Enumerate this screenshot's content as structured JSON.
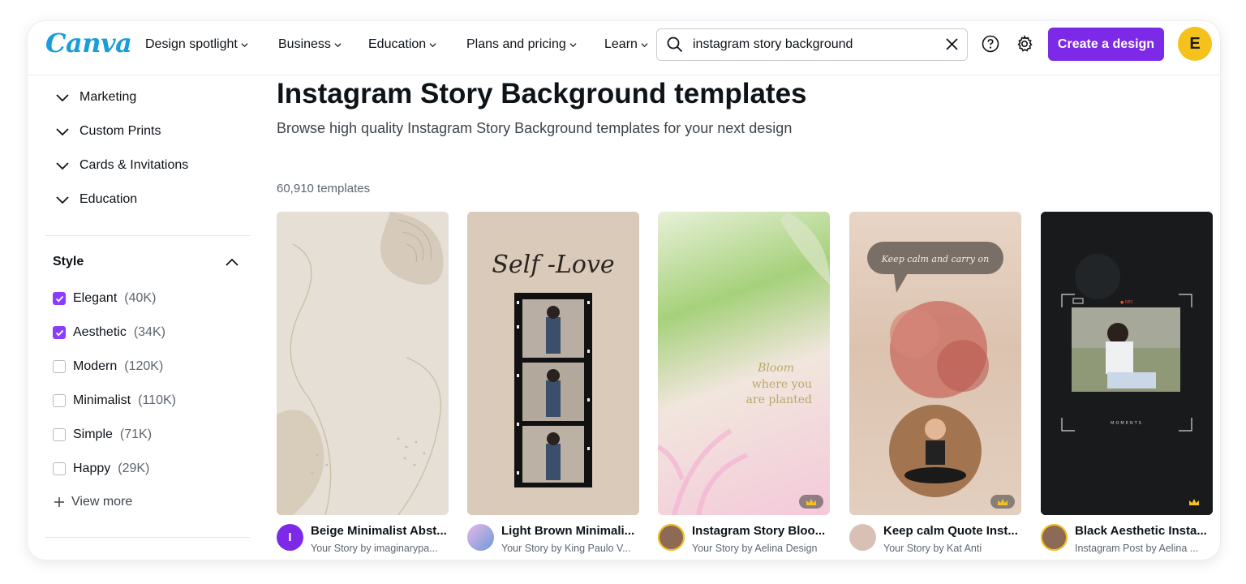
{
  "header": {
    "logo": "Canva",
    "nav": [
      {
        "label": "Design spotlight"
      },
      {
        "label": "Business"
      },
      {
        "label": "Education"
      },
      {
        "label": "Plans and pricing"
      },
      {
        "label": "Learn"
      }
    ],
    "search": {
      "value": "instagram story background",
      "placeholder": "Search"
    },
    "create_label": "Create a design",
    "avatar_initial": "E",
    "brand_color": "#7d2ae8",
    "avatar_color": "#f5c21b"
  },
  "sidebar": {
    "categories": [
      {
        "label": "Marketing"
      },
      {
        "label": "Custom Prints"
      },
      {
        "label": "Cards & Invitations"
      },
      {
        "label": "Education"
      }
    ],
    "style": {
      "heading": "Style",
      "options": [
        {
          "label": "Elegant",
          "count": "(40K)",
          "checked": true
        },
        {
          "label": "Aesthetic",
          "count": "(34K)",
          "checked": true
        },
        {
          "label": "Modern",
          "count": "(120K)",
          "checked": false
        },
        {
          "label": "Minimalist",
          "count": "(110K)",
          "checked": false
        },
        {
          "label": "Simple",
          "count": "(71K)",
          "checked": false
        },
        {
          "label": "Happy",
          "count": "(29K)",
          "checked": false
        }
      ],
      "view_more": "View more"
    }
  },
  "main": {
    "title": "Instagram Story Background templates",
    "subtitle": "Browse high quality Instagram Story Background templates for your next design",
    "count": "60,910 templates",
    "cards": [
      {
        "name": "Beige Minimalist Abst...",
        "byline": "Your Story by imaginarypa...",
        "avatar_letter": "I",
        "premium": false
      },
      {
        "name": "Light Brown Minimali...",
        "byline": "Your Story by King Paulo V...",
        "overlay": "Self -Love",
        "premium": false
      },
      {
        "name": "Instagram Story Bloo...",
        "byline": "Your Story by Aelina Design",
        "overlay_lines": [
          "Bloom",
          "where you",
          "are planted"
        ],
        "premium": true
      },
      {
        "name": "Keep calm Quote Inst...",
        "byline": "Your Story by Kat Anti",
        "overlay": "Keep calm and carry on",
        "premium": true
      },
      {
        "name": "Black Aesthetic Insta...",
        "byline": "Instagram Post by Aelina ...",
        "overlay_small": [
          "● REC",
          "MOMENTS"
        ],
        "premium": true
      }
    ]
  }
}
